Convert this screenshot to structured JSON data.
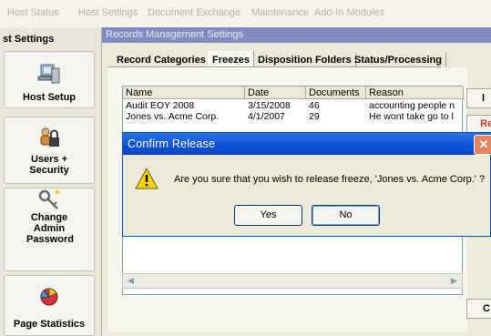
{
  "top_nav": [
    "Host Status",
    "Host Settings",
    "Document Exchange",
    "Maintenance",
    "Add-In Modules"
  ],
  "sidebar": {
    "title": "st Settings",
    "items": [
      {
        "label": "Host Setup",
        "icon": "server-icon"
      },
      {
        "label": "Users + Security",
        "icon": "users-lock-icon"
      },
      {
        "label": "Change Admin Password",
        "icon": "key-icon"
      },
      {
        "label": "Page Statistics",
        "icon": "pie-chart-icon"
      }
    ]
  },
  "main": {
    "header": "Records Management Settings",
    "tabs": [
      "Record Categories",
      "Freezes",
      "Disposition Folders",
      "Status/Processing"
    ],
    "active_tab": "Freezes",
    "table": {
      "columns": [
        "Name",
        "Date",
        "Documents",
        "Reason"
      ],
      "rows": [
        {
          "name": "Audit EOY 2008",
          "date": "3/15/2008",
          "documents": "46",
          "reason": "accounting people n"
        },
        {
          "name": "Jones vs. Acme Corp.",
          "date": "4/1/2007",
          "documents": "29",
          "reason": "He wont take go to l"
        }
      ]
    },
    "right_buttons": [
      "l",
      "Re",
      "C"
    ]
  },
  "dialog": {
    "title": "Confirm Release",
    "message": "Are you sure that you wish to release freeze, 'Jones vs. Acme Corp.' ?",
    "yes_label": "Yes",
    "no_label": "No",
    "icon": "warning-icon"
  },
  "colors": {
    "dialog_title_bar": "#0a52d6",
    "panel_header": "#7f8cc0",
    "window_bg": "#ece9d8"
  }
}
